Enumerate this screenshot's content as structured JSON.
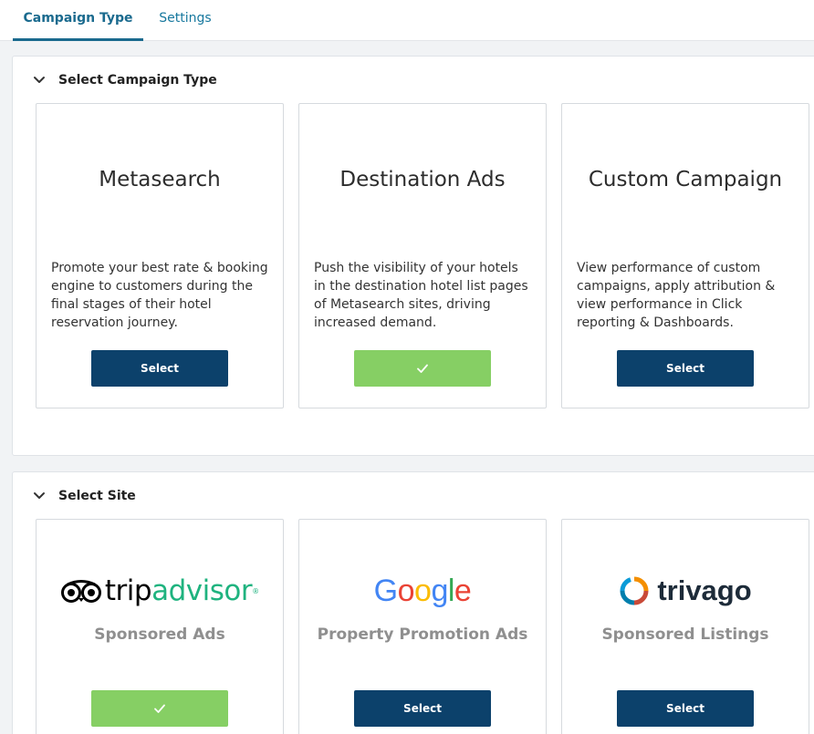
{
  "tabs": [
    {
      "label": "Campaign Type",
      "active": true
    },
    {
      "label": "Settings",
      "active": false
    }
  ],
  "campaign_section": {
    "title": "Select Campaign Type",
    "cards": [
      {
        "title": "Metasearch",
        "description": "Promote your best rate & booking engine to customers during the final stages of their hotel reservation journey.",
        "button_label": "Select",
        "selected": false
      },
      {
        "title": "Destination Ads",
        "description": "Push the visibility of your hotels in the destination hotel list pages of Metasearch sites, driving increased demand.",
        "button_label": "",
        "selected": true
      },
      {
        "title": "Custom Campaign",
        "description": "View performance of custom campaigns, apply attribution & view performance in Click reporting & Dashboards.",
        "button_label": "Select",
        "selected": false
      }
    ]
  },
  "site_section": {
    "title": "Select Site",
    "cards": [
      {
        "logo_parts": [
          "trip",
          "advisor",
          "®"
        ],
        "subtitle": "Sponsored Ads",
        "button_label": "",
        "selected": true
      },
      {
        "logo_letters": [
          "G",
          "o",
          "o",
          "g",
          "l",
          "e"
        ],
        "subtitle": "Property Promotion Ads",
        "button_label": "Select",
        "selected": false
      },
      {
        "logo_text": "trivago",
        "subtitle": "Sponsored Listings",
        "button_label": "Select",
        "selected": false
      }
    ]
  },
  "colors": {
    "accent": "#1a6a8e",
    "button_primary": "#0c416b",
    "button_selected": "#86cf64",
    "google_blue": "#4285f4",
    "google_red": "#ea4335",
    "google_yellow": "#fbbc05",
    "google_green": "#34a853"
  },
  "icons": {
    "collapse": "chevron-down-icon",
    "selected": "check-icon"
  }
}
